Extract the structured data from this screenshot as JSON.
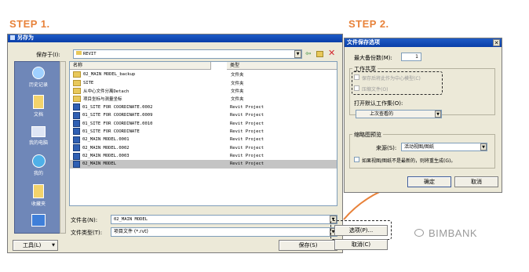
{
  "steps": {
    "step1": "STEP 1.",
    "step2": "STEP 2."
  },
  "save_dialog": {
    "title": "另存为",
    "save_in_label": "保存于(I):",
    "save_in_value": "REVIT",
    "places": [
      {
        "name": "history",
        "label": "历史记录",
        "icon": "history-icon"
      },
      {
        "name": "documents",
        "label": "文档",
        "icon": "documents-icon"
      },
      {
        "name": "my-computer",
        "label": "我的电脑",
        "icon": "computer-icon"
      },
      {
        "name": "my-network",
        "label": "我的",
        "icon": "network-icon"
      },
      {
        "name": "favorites",
        "label": "收藏夹",
        "icon": "favorites-icon"
      },
      {
        "name": "desktop",
        "label": "",
        "icon": "desktop-icon"
      }
    ],
    "columns": {
      "name": "名称",
      "type": "类型"
    },
    "files": [
      {
        "name": "02_MAIN MODEL_backup",
        "type": "文件夹",
        "icon": "folder-icon"
      },
      {
        "name": "SITE",
        "type": "文件夹",
        "icon": "folder-icon"
      },
      {
        "name": "从中心文件分离Detach",
        "type": "文件夹",
        "icon": "folder-icon"
      },
      {
        "name": "项目坐标与测量坐标",
        "type": "文件夹",
        "icon": "folder-icon"
      },
      {
        "name": "01_SITE FOR COORDINATE.0002",
        "type": "Revit Project",
        "icon": "rvt-file-icon"
      },
      {
        "name": "01_SITE FOR COORDINATE.0009",
        "type": "Revit Project",
        "icon": "rvt-file-icon"
      },
      {
        "name": "01_SITE FOR COORDINATE.0010",
        "type": "Revit Project",
        "icon": "rvt-file-icon"
      },
      {
        "name": "01_SITE FOR COORDINATE",
        "type": "Revit Project",
        "icon": "rvt-file-icon"
      },
      {
        "name": "02_MAIN MODEL.0001",
        "type": "Revit Project",
        "icon": "rvt-file-icon"
      },
      {
        "name": "02_MAIN MODEL.0002",
        "type": "Revit Project",
        "icon": "rvt-file-icon"
      },
      {
        "name": "02_MAIN MODEL.0003",
        "type": "Revit Project",
        "icon": "rvt-file-icon"
      },
      {
        "name": "02_MAIN MODEL",
        "type": "Revit Project",
        "icon": "rvt-file-icon",
        "selected": true
      }
    ],
    "filename_label": "文件名(N):",
    "filename_value": "02_MAIN MODEL",
    "filetype_label": "文件类型(T):",
    "filetype_value": "项目文件 (*.rvt)",
    "tools_button": "工具(L)",
    "options_button": "选项(P)...",
    "save_button": "保存(S)",
    "cancel_button": "取消(C)"
  },
  "options_dialog": {
    "title": "文件保存选项",
    "max_backups_label": "最大备份数(M):",
    "max_backups_value": "1",
    "worksharing_group": "工作共享",
    "checkbox1_label": "保存后将此作为中心模型(C)",
    "checkbox2_label": "压缩文件(O)",
    "open_workset_label": "打开默认工作集(O):",
    "open_workset_value": "上次查看的",
    "thumbnail_group": "缩略图预览",
    "source_label": "来源(S):",
    "source_value": "活动视图/图纸",
    "regen_label": "如果视图/图纸不是最新的，则将重生成(G)。",
    "ok_button": "确定",
    "cancel_button": "取消"
  },
  "watermark": "BIMBANK",
  "colors": {
    "step": "#e8823a",
    "title_bar": "#0a3ea8",
    "places_bg": "#6f87b8",
    "selection": "#c4c4c4"
  }
}
